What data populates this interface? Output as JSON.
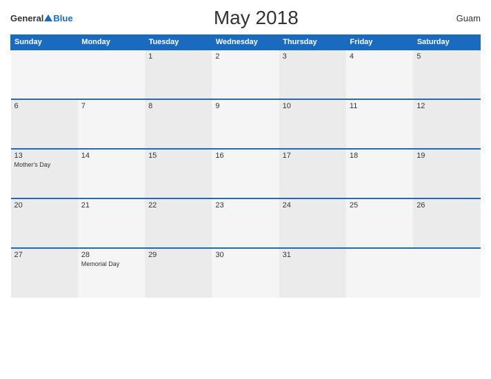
{
  "header": {
    "logo_general": "General",
    "logo_blue": "Blue",
    "title": "May 2018",
    "region": "Guam"
  },
  "calendar": {
    "weekdays": [
      "Sunday",
      "Monday",
      "Tuesday",
      "Wednesday",
      "Thursday",
      "Friday",
      "Saturday"
    ],
    "weeks": [
      [
        {
          "day": "",
          "event": ""
        },
        {
          "day": "",
          "event": ""
        },
        {
          "day": "1",
          "event": ""
        },
        {
          "day": "2",
          "event": ""
        },
        {
          "day": "3",
          "event": ""
        },
        {
          "day": "4",
          "event": ""
        },
        {
          "day": "5",
          "event": ""
        }
      ],
      [
        {
          "day": "6",
          "event": ""
        },
        {
          "day": "7",
          "event": ""
        },
        {
          "day": "8",
          "event": ""
        },
        {
          "day": "9",
          "event": ""
        },
        {
          "day": "10",
          "event": ""
        },
        {
          "day": "11",
          "event": ""
        },
        {
          "day": "12",
          "event": ""
        }
      ],
      [
        {
          "day": "13",
          "event": "Mother's Day"
        },
        {
          "day": "14",
          "event": ""
        },
        {
          "day": "15",
          "event": ""
        },
        {
          "day": "16",
          "event": ""
        },
        {
          "day": "17",
          "event": ""
        },
        {
          "day": "18",
          "event": ""
        },
        {
          "day": "19",
          "event": ""
        }
      ],
      [
        {
          "day": "20",
          "event": ""
        },
        {
          "day": "21",
          "event": ""
        },
        {
          "day": "22",
          "event": ""
        },
        {
          "day": "23",
          "event": ""
        },
        {
          "day": "24",
          "event": ""
        },
        {
          "day": "25",
          "event": ""
        },
        {
          "day": "26",
          "event": ""
        }
      ],
      [
        {
          "day": "27",
          "event": ""
        },
        {
          "day": "28",
          "event": "Memorial Day"
        },
        {
          "day": "29",
          "event": ""
        },
        {
          "day": "30",
          "event": ""
        },
        {
          "day": "31",
          "event": ""
        },
        {
          "day": "",
          "event": ""
        },
        {
          "day": "",
          "event": ""
        }
      ]
    ]
  }
}
